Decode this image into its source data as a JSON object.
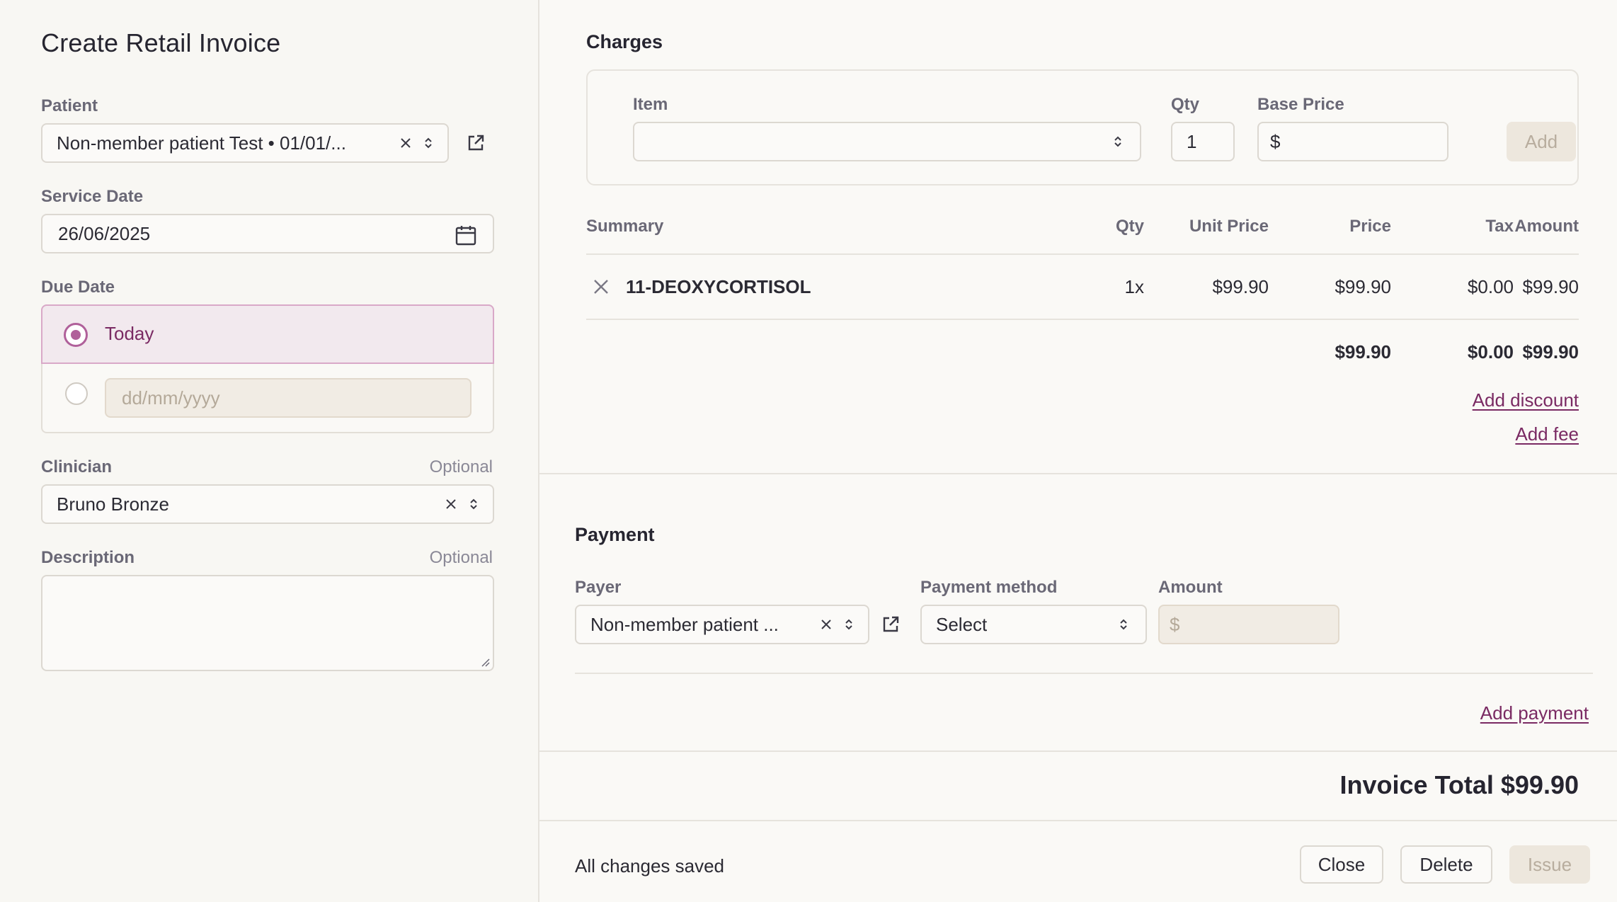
{
  "left": {
    "title": "Create Retail Invoice",
    "patient": {
      "label": "Patient",
      "value": "Non-member patient Test • 01/01/..."
    },
    "service_date": {
      "label": "Service Date",
      "value": "26/06/2025"
    },
    "due_date": {
      "label": "Due Date",
      "option_today": "Today",
      "custom_placeholder": "dd/mm/yyyy"
    },
    "clinician": {
      "label": "Clinician",
      "optional": "Optional",
      "value": "Bruno Bronze"
    },
    "description": {
      "label": "Description",
      "optional": "Optional"
    }
  },
  "charges": {
    "title": "Charges",
    "add_form": {
      "item_label": "Item",
      "qty_label": "Qty",
      "qty_value": "1",
      "base_price_label": "Base Price",
      "currency": "$",
      "add_label": "Add"
    },
    "table": {
      "headers": [
        "Summary",
        "Qty",
        "Unit Price",
        "Price",
        "Tax",
        "Amount"
      ],
      "rows": [
        {
          "summary": "11-DEOXYCORTISOL",
          "qty": "1x",
          "unit_price": "$99.90",
          "price": "$99.90",
          "tax": "$0.00",
          "amount": "$99.90"
        }
      ],
      "totals": {
        "price": "$99.90",
        "tax": "$0.00",
        "amount": "$99.90"
      }
    },
    "add_discount": "Add discount",
    "add_fee": "Add fee"
  },
  "payment": {
    "title": "Payment",
    "payer_label": "Payer",
    "payer_value": "Non-member patient ...",
    "method_label": "Payment method",
    "method_value": "Select",
    "amount_label": "Amount",
    "amount_placeholder": "$",
    "add_payment": "Add payment"
  },
  "invoice_total": "Invoice Total $99.90",
  "footer": {
    "status": "All changes saved",
    "close": "Close",
    "delete": "Delete",
    "issue": "Issue"
  },
  "colors": {
    "accent": "#7a2a63",
    "radio_accent": "#b0609a",
    "selected_bg": "#f2e9ee"
  }
}
